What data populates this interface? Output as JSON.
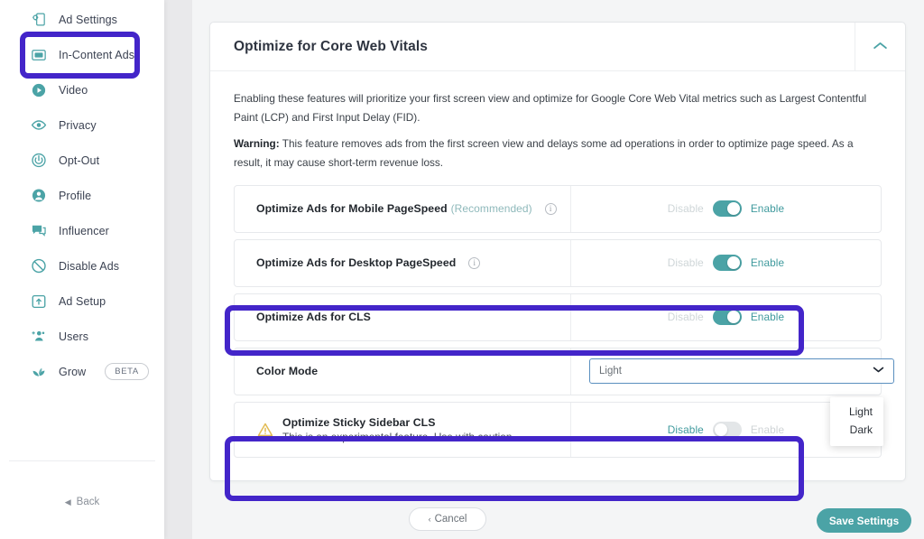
{
  "sidebar": {
    "items": [
      {
        "label": "Ad Settings",
        "icon": "ad-settings-icon",
        "highlighted": false
      },
      {
        "label": "In-Content Ads",
        "icon": "in-content-ads-icon",
        "highlighted": true
      },
      {
        "label": "Video",
        "icon": "video-icon",
        "highlighted": false
      },
      {
        "label": "Privacy",
        "icon": "privacy-eye-icon",
        "highlighted": false
      },
      {
        "label": "Opt-Out",
        "icon": "power-icon",
        "highlighted": false
      },
      {
        "label": "Profile",
        "icon": "profile-person-icon",
        "highlighted": false
      },
      {
        "label": "Influencer",
        "icon": "chat-bubble-icon",
        "highlighted": false
      },
      {
        "label": "Disable Ads",
        "icon": "block-icon",
        "highlighted": false
      },
      {
        "label": "Ad Setup",
        "icon": "ad-setup-upload-icon",
        "highlighted": false
      },
      {
        "label": "Users",
        "icon": "add-users-icon",
        "highlighted": false
      },
      {
        "label": "Grow",
        "icon": "grow-leaf-icon",
        "badge": "BETA",
        "highlighted": false
      }
    ],
    "back_label": "Back"
  },
  "card": {
    "title": "Optimize for Core Web Vitals",
    "collapse_icon": "chevron-up-icon",
    "description_1": "Enabling these features will prioritize your first screen view and optimize for Google Core Web Vital metrics such as Largest Contentful Paint (LCP) and First Input Delay (FID).",
    "warning_label": "Warning:",
    "warning_text": " This feature removes ads from the first screen view and delays some ad operations in order to optimize page speed. As a result, it may cause short-term revenue loss.",
    "rows": [
      {
        "id": "mobile-pagespeed",
        "label": "Optimize Ads for Mobile PageSpeed",
        "annotation": "(Recommended)",
        "info_icon": "info-icon",
        "control": "toggle",
        "off_label": "Disable",
        "on_label": "Enable",
        "state": "on",
        "highlighted": false
      },
      {
        "id": "desktop-pagespeed",
        "label": "Optimize Ads for Desktop PageSpeed",
        "annotation": "",
        "info_icon": "info-icon",
        "control": "toggle",
        "off_label": "Disable",
        "on_label": "Enable",
        "state": "on",
        "highlighted": false
      },
      {
        "id": "cls",
        "label": "Optimize Ads for CLS",
        "annotation": "",
        "info_icon": "",
        "control": "toggle",
        "off_label": "Disable",
        "on_label": "Enable",
        "state": "on",
        "highlighted": true
      },
      {
        "id": "color-mode",
        "label": "Color Mode",
        "annotation": "",
        "info_icon": "",
        "control": "select",
        "value": "Light",
        "caret_icon": "chevron-down-icon",
        "highlighted": false
      },
      {
        "id": "sticky-sidebar-cls",
        "label": "Optimize Sticky Sidebar CLS",
        "sub_label": "This is an experimental feature. Use with caution.",
        "warning_icon": "warning-triangle-icon",
        "control": "toggle",
        "off_label": "Disable",
        "on_label": "Enable",
        "state": "off",
        "highlighted": true
      }
    ]
  },
  "select_menu": {
    "options": [
      "Light",
      "Dark"
    ]
  },
  "footer": {
    "cancel_label": "Cancel",
    "cancel_caret": "‹",
    "save_label": "Save Settings"
  },
  "colors": {
    "accent_teal": "#4ba3a6",
    "highlight_purple": "#4325c9",
    "warning_amber": "#e8c35b"
  }
}
